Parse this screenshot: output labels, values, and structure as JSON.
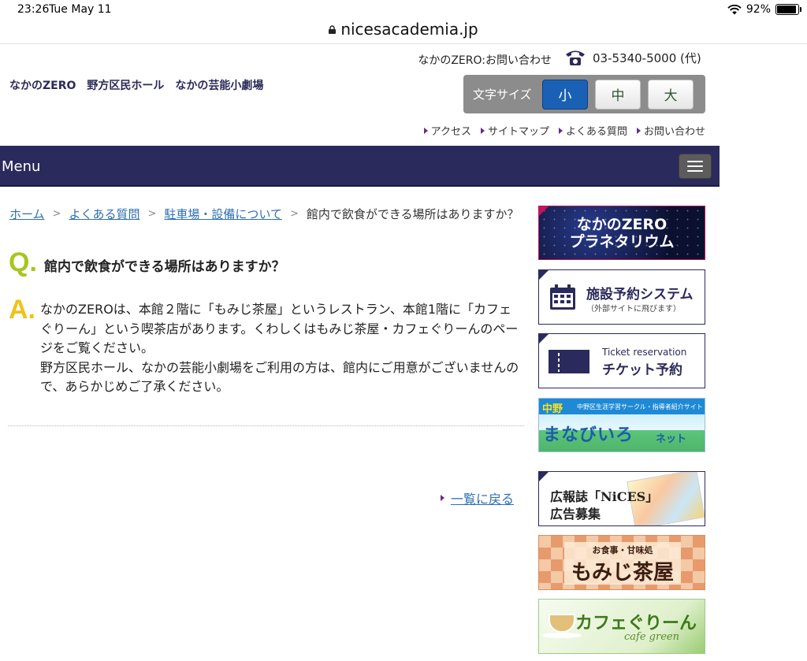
{
  "status": {
    "time": "23:26",
    "date": "Tue May 11",
    "battery": "92%",
    "battery_level": 0.92
  },
  "browser": {
    "url": "nicesacademia.jp"
  },
  "header": {
    "site_name": "なかのZERO　野方区民ホール　なかの芸能小劇場",
    "contact_label": "なかのZERO:お問い合わせ",
    "phone": "03-5340-5000 (代)",
    "font_size": {
      "label": "文字サイズ",
      "small": "小",
      "medium": "中",
      "large": "大",
      "selected": "小"
    },
    "links": [
      "アクセス",
      "サイトマップ",
      "よくある質問",
      "お問い合わせ"
    ]
  },
  "nav": {
    "menu_label": "Menu"
  },
  "breadcrumb": {
    "home": "ホーム",
    "faq": "よくある質問",
    "category": "駐車場・設備について",
    "current": "館内で飲食ができる場所はありますか？"
  },
  "qa": {
    "q_mark": "Q.",
    "question": "館内で飲食ができる場所はありますか？",
    "a_mark": "A.",
    "answer_1": "なかのZEROは、本館２階に「もみじ茶屋」というレストラン、本館1階に「カフェぐりーん」という喫茶店があります。くわしくはもみじ茶屋・カフェぐりーんのページをご覧ください。",
    "answer_2": "野方区民ホール、なかの芸能小劇場をご利用の方は、館内にご用意がございませんので、あらかじめご了承ください。"
  },
  "back_link": "一覧に戻る",
  "banners": {
    "planetarium": {
      "line1": "なかのZERO",
      "line2": "プラネタリウム"
    },
    "facility": {
      "title": "施設予約システム",
      "sub": "（外部サイトに飛びます）"
    },
    "ticket": {
      "sub": "Ticket reservation",
      "title": "チケット予約"
    },
    "manabi": {
      "nakano": "中野",
      "subtitle": "中野区生涯学習サークル・指導者紹介サイト",
      "big": "まなびいろ",
      "net": "ネット"
    },
    "nices": {
      "line1": "広報誌「NiCES」",
      "line2": "広告募集"
    },
    "momiji": {
      "small": "お食事・甘味処",
      "big": "もみじ茶屋"
    },
    "cafe": {
      "big": "カフェぐりーん",
      "small": "cafe green"
    }
  },
  "colors": {
    "navy": "#2b2a5d",
    "link": "#2e6fb5",
    "q": "#a7c61e",
    "a": "#f0c21a",
    "active_button": "#1a61b5"
  }
}
